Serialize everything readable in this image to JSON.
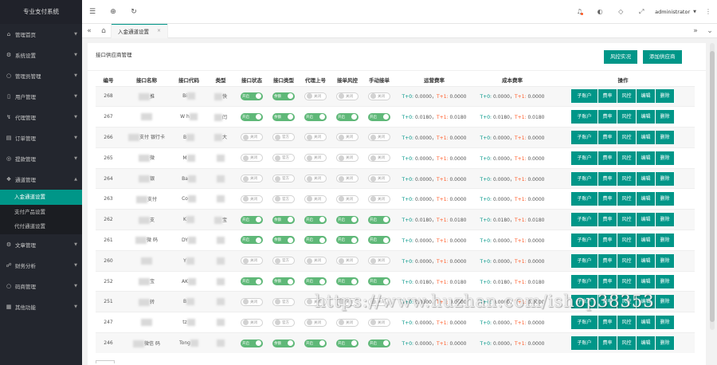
{
  "app": {
    "title": "专业支付系统"
  },
  "sidebar": {
    "items": [
      {
        "icon": "home-icon",
        "glyph": "⌂",
        "label": "管理首页"
      },
      {
        "icon": "gear-icon",
        "glyph": "⚙",
        "label": "系统设置"
      },
      {
        "icon": "user-icon",
        "glyph": "○",
        "label": "管理员管理"
      },
      {
        "icon": "users-icon",
        "glyph": "▯",
        "label": "用户管理"
      },
      {
        "icon": "agent-icon",
        "glyph": "↯",
        "label": "代理管理"
      },
      {
        "icon": "cart-icon",
        "glyph": "▤",
        "label": "订单管理"
      },
      {
        "icon": "withdraw-icon",
        "glyph": "◎",
        "label": "提款管理"
      },
      {
        "icon": "channel-icon",
        "glyph": "❖",
        "label": "通道管理"
      }
    ],
    "submenu": [
      "入金通道设置",
      "支付产品设置",
      "代付通道设置"
    ],
    "items_after": [
      {
        "icon": "article-icon",
        "glyph": "⚙",
        "label": "文章管理"
      },
      {
        "icon": "finance-icon",
        "glyph": "☍",
        "label": "财务分析"
      },
      {
        "icon": "shop-icon",
        "glyph": "○",
        "label": "码商管理"
      },
      {
        "icon": "other-icon",
        "glyph": "▦",
        "label": "其他功能"
      }
    ]
  },
  "topbar": {
    "admin": "administrator",
    "icons": [
      "menu-toggle-icon",
      "globe-icon",
      "refresh-icon"
    ]
  },
  "tabs": {
    "active": "入金通道设置"
  },
  "main": {
    "card_title": "接口供应商管理",
    "risk_button": "风控实况",
    "add_button": "添加供应商",
    "columns": [
      "编号",
      "接口名称",
      "接口代码",
      "类型",
      "接口状态",
      "接口类型",
      "代理上号",
      "接单风控",
      "手动接单",
      "运营费率",
      "成本费率",
      "操作"
    ],
    "ops": [
      "子账户",
      "费率",
      "风控",
      "编辑",
      "删除"
    ],
    "toggle_labels": {
      "on": "开启",
      "off": "关闭",
      "type_on": "余额",
      "type_off": "官方"
    },
    "rows": [
      {
        "id": "268",
        "name": "推",
        "code": "Bi",
        "type": "快",
        "status": true,
        "itype": true,
        "agent": false,
        "risk": false,
        "manual": false,
        "op_t0": "0.0000",
        "op_t1": "0.0000",
        "cost_t0": "0.0000",
        "cost_t1": "0.0000"
      },
      {
        "id": "267",
        "name": "",
        "code": "W   h",
        "type": "闫",
        "status": true,
        "itype": true,
        "agent": true,
        "risk": true,
        "manual": true,
        "op_t0": "0.0180",
        "op_t1": "0.0180",
        "cost_t0": "0.0180",
        "cost_t1": "0.0180"
      },
      {
        "id": "266",
        "name": "支付   银行卡",
        "code": "B",
        "type": "大",
        "status": false,
        "itype": false,
        "agent": false,
        "risk": false,
        "manual": false,
        "op_t0": "0.0000",
        "op_t1": "0.0000",
        "cost_t0": "0.0000",
        "cost_t1": "0.0000"
      },
      {
        "id": "265",
        "name": "微",
        "code": "M",
        "type": "",
        "status": false,
        "itype": false,
        "agent": false,
        "risk": false,
        "manual": false,
        "op_t0": "0.0000",
        "op_t1": "0.0000",
        "cost_t0": "0.0000",
        "cost_t1": "0.0000"
      },
      {
        "id": "264",
        "name": "银",
        "code": "Ba",
        "type": "",
        "status": false,
        "itype": false,
        "agent": false,
        "risk": false,
        "manual": false,
        "op_t0": "0.0000",
        "op_t1": "0.0000",
        "cost_t0": "0.0000",
        "cost_t1": "0.0000"
      },
      {
        "id": "263",
        "name": "支付",
        "code": "Co",
        "type": "",
        "status": false,
        "itype": false,
        "agent": false,
        "risk": false,
        "manual": false,
        "op_t0": "0.0000",
        "op_t1": "0.0000",
        "cost_t0": "0.0000",
        "cost_t1": "0.0000"
      },
      {
        "id": "262",
        "name": "支",
        "code": "K",
        "type": "宝",
        "status": true,
        "itype": true,
        "agent": true,
        "risk": true,
        "manual": true,
        "op_t0": "0.0180",
        "op_t1": "0.0180",
        "cost_t0": "0.0180",
        "cost_t1": "0.0180"
      },
      {
        "id": "261",
        "name": "微   码",
        "code": "DY",
        "type": "",
        "status": true,
        "itype": true,
        "agent": true,
        "risk": true,
        "manual": true,
        "op_t0": "0.0000",
        "op_t1": "0.0000",
        "cost_t0": "0.0000",
        "cost_t1": "0.0000"
      },
      {
        "id": "260",
        "name": "",
        "code": "Y",
        "type": "",
        "status": false,
        "itype": false,
        "agent": false,
        "risk": false,
        "manual": false,
        "op_t0": "0.0000",
        "op_t1": "0.0000",
        "cost_t0": "0.0000",
        "cost_t1": "0.0000"
      },
      {
        "id": "252",
        "name": "宝",
        "code": "AK",
        "type": "",
        "status": true,
        "itype": true,
        "agent": true,
        "risk": true,
        "manual": true,
        "op_t0": "0.0180",
        "op_t1": "0.0180",
        "cost_t0": "0.0180",
        "cost_t1": "0.0180"
      },
      {
        "id": "251",
        "name": "转",
        "code": "B",
        "type": "",
        "status": false,
        "itype": false,
        "agent": false,
        "risk": false,
        "manual": false,
        "op_t0": "0.0000",
        "op_t1": "0.0000",
        "cost_t0": "0.0000",
        "cost_t1": "0.0000"
      },
      {
        "id": "247",
        "name": "",
        "code": "tz",
        "type": "",
        "status": false,
        "itype": false,
        "agent": false,
        "risk": false,
        "manual": false,
        "op_t0": "0.0000",
        "op_t1": "0.0000",
        "cost_t0": "0.0000",
        "cost_t1": "0.0000"
      },
      {
        "id": "246",
        "name": "微信   码",
        "code": "Tong",
        "type": "",
        "status": true,
        "itype": true,
        "agent": true,
        "risk": true,
        "manual": true,
        "op_t0": "0.0000",
        "op_t1": "0.0000",
        "cost_t0": "0.0000",
        "cost_t1": "0.0000"
      }
    ]
  },
  "watermark": "https://www.huzhan.com/ishop38353",
  "colors": {
    "accent": "#009688",
    "toggle_on": "#5fb878",
    "sidebar": "#23262e",
    "rate_red": "#ff5722"
  }
}
